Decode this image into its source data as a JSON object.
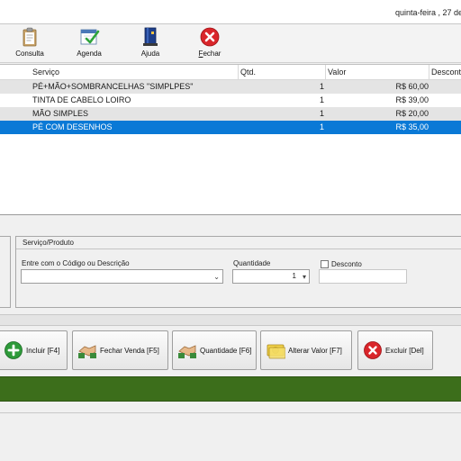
{
  "header": {
    "date_text": "quinta-feira , 27  de"
  },
  "toolbar": {
    "items": [
      {
        "label_pre": "",
        "label_u": "",
        "label_post": "Consulta",
        "icon": "clipboard-icon"
      },
      {
        "label_pre": "",
        "label_u": "",
        "label_post": "Agenda",
        "icon": "calendar-check-icon"
      },
      {
        "label_pre": "",
        "label_u": "",
        "label_post": "Ajuda",
        "icon": "help-book-icon"
      },
      {
        "label_pre": "",
        "label_u": "F",
        "label_post": "echar",
        "icon": "close-icon"
      }
    ]
  },
  "grid": {
    "columns": {
      "servico": "Serviço",
      "qtd": "Qtd.",
      "valor": "Valor",
      "desconto": "Desconto"
    },
    "rows": [
      {
        "servico": "PÉ+MÃO+SOMBRANCELHAS \"SIMPLPES\"",
        "qtd": "1",
        "valor": "R$ 60,00"
      },
      {
        "servico": "TINTA DE CABELO LOIRO",
        "qtd": "1",
        "valor": "R$ 39,00"
      },
      {
        "servico": "MÃO SIMPLES",
        "qtd": "1",
        "valor": "R$ 20,00"
      },
      {
        "servico": "PÉ COM DESENHOS",
        "qtd": "1",
        "valor": "R$ 35,00"
      }
    ]
  },
  "form": {
    "panel_title": "Serviço/Produto",
    "code_label": "Entre com o Código ou Descrição",
    "code_value": "",
    "qty_label": "Quantidade",
    "qty_value": "1",
    "discount_label": "Desconto",
    "discount_value": ""
  },
  "actions": [
    {
      "label": "Incluir [F4]",
      "icon": "add-icon"
    },
    {
      "label": "Fechar Venda [F5]",
      "icon": "handshake-icon"
    },
    {
      "label": "Quantidade [F6]",
      "icon": "handshake-icon"
    },
    {
      "label": "Alterar Valor [F7]",
      "icon": "money-icon"
    },
    {
      "label": "Excluir [Del]",
      "icon": "delete-icon"
    }
  ],
  "colors": {
    "selection": "#0a79d6",
    "total_bar": "#3c6e1b",
    "close_red": "#d9252a",
    "add_green": "#2e9a3a"
  }
}
